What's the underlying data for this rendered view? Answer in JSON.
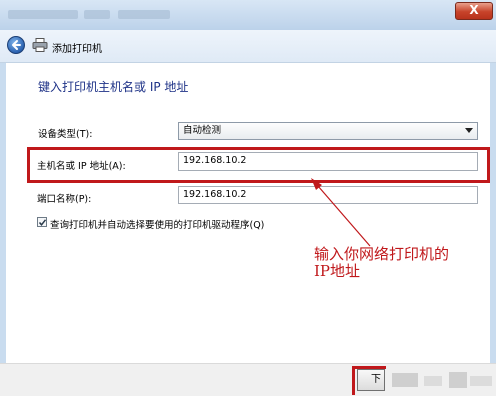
{
  "window": {
    "close_label": "X"
  },
  "nav": {
    "title": "添加打印机"
  },
  "main": {
    "heading": "键入打印机主机名或 IP 地址",
    "device_type_label": "设备类型(T):",
    "device_type_value": "自动检测",
    "hostname_label": "主机名或 IP 地址(A):",
    "hostname_value": "192.168.10.2",
    "port_label": "端口名称(P):",
    "port_value": "192.168.10.2",
    "checkbox_label": "查询打印机并自动选择要使用的打印机驱动程序(Q)",
    "checkbox_checked": true
  },
  "annotation": {
    "line1": "输入你网络打印机的",
    "line2": "IP地址"
  },
  "footer": {
    "next_label": "下"
  },
  "colors": {
    "highlight": "#c0181b",
    "heading": "#1e3287"
  }
}
